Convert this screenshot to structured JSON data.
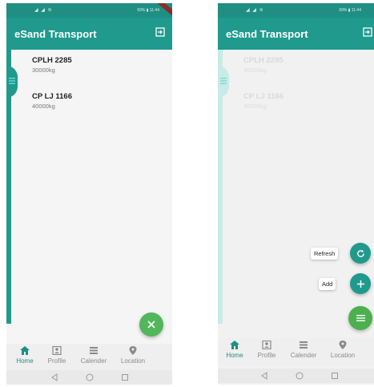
{
  "app": {
    "title": "eSand Transport"
  },
  "statusbar": {
    "battery_text": "69% ▮ 11:44"
  },
  "vehicles": [
    {
      "plate": "CPLH 2285",
      "weight": "30000kg"
    },
    {
      "plate": "CP LJ 1166",
      "weight": "40000kg"
    }
  ],
  "fab_menu": {
    "refresh_label": "Refresh",
    "add_label": "Add"
  },
  "nav": {
    "items": [
      {
        "label": "Home",
        "icon": "home-icon"
      },
      {
        "label": "Profile",
        "icon": "profile-icon"
      },
      {
        "label": "Calender",
        "icon": "calendar-icon"
      },
      {
        "label": "Location",
        "icon": "location-icon"
      }
    ]
  },
  "colors": {
    "primary": "#1f9a8c",
    "fab_green": "#4cb04f",
    "active_nav": "#1f8f83"
  }
}
